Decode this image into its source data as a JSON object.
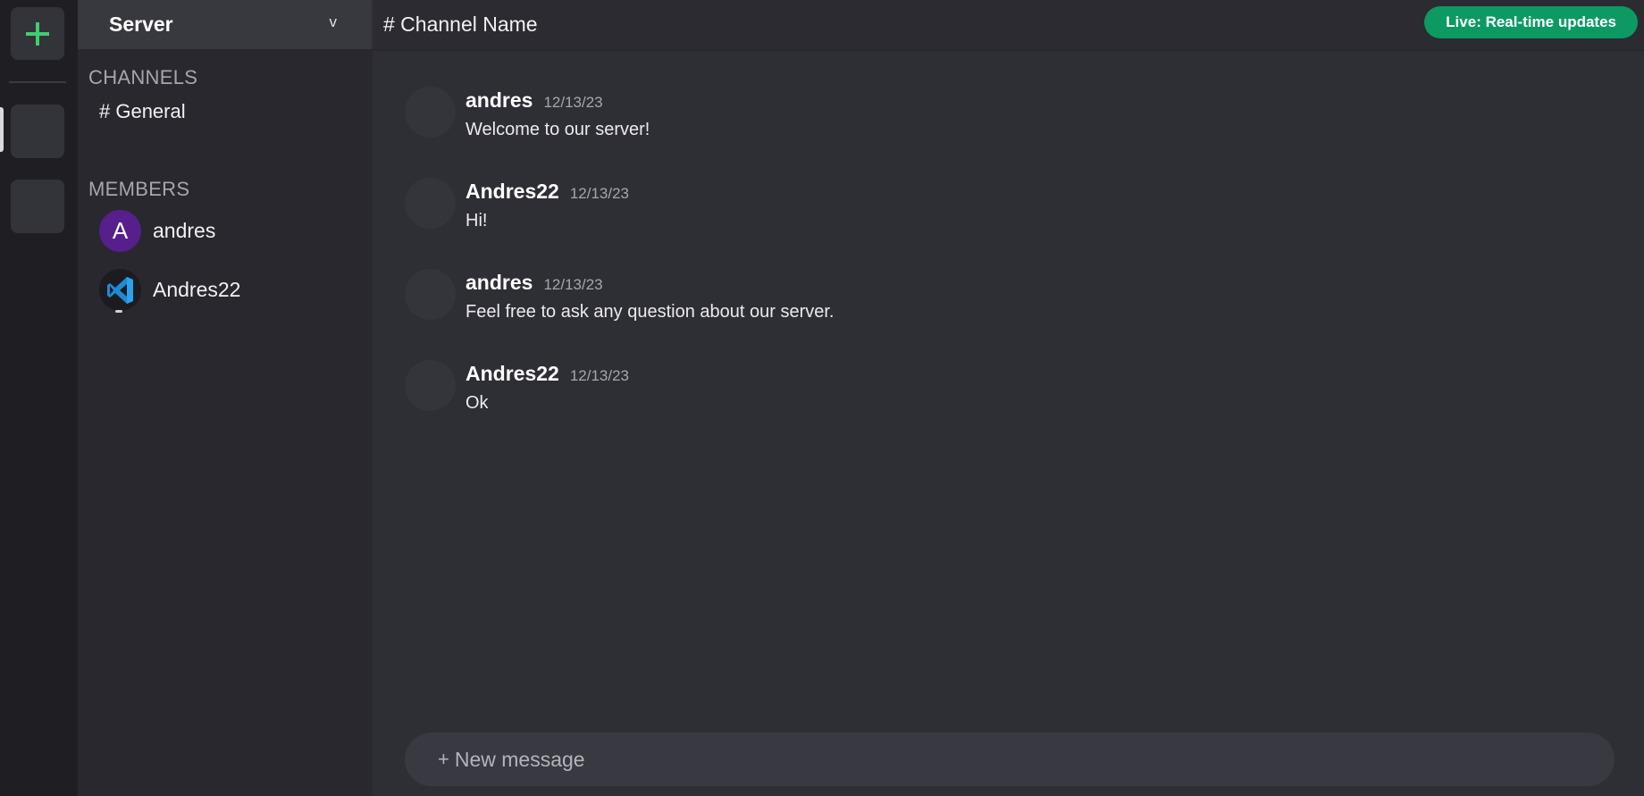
{
  "rail": {
    "add_icon": "plus-icon",
    "accent": "#3ecf6e"
  },
  "sidebar": {
    "server_name": "Server",
    "chevron": "v",
    "channels_title": "CHANNELS",
    "channels": [
      {
        "label": "# General"
      }
    ],
    "members_title": "MEMBERS",
    "members": [
      {
        "name": "andres",
        "avatar_letter": "A",
        "avatar_color": "#561f8b"
      },
      {
        "name": "Andres22",
        "avatar_icon": "vscode-logo-icon"
      }
    ]
  },
  "header": {
    "channel_title": "# Channel Name",
    "live_badge": "Live: Real-time updates",
    "live_color": "#0c9a62"
  },
  "messages": [
    {
      "author": "andres",
      "time": "12/13/23",
      "text": "Welcome to our server!"
    },
    {
      "author": "Andres22",
      "time": "12/13/23",
      "text": "Hi!"
    },
    {
      "author": "andres",
      "time": "12/13/23",
      "text": "Feel free to ask any question about our server."
    },
    {
      "author": "Andres22",
      "time": "12/13/23",
      "text": "Ok"
    }
  ],
  "composer": {
    "plus": "+",
    "placeholder": "New message"
  }
}
